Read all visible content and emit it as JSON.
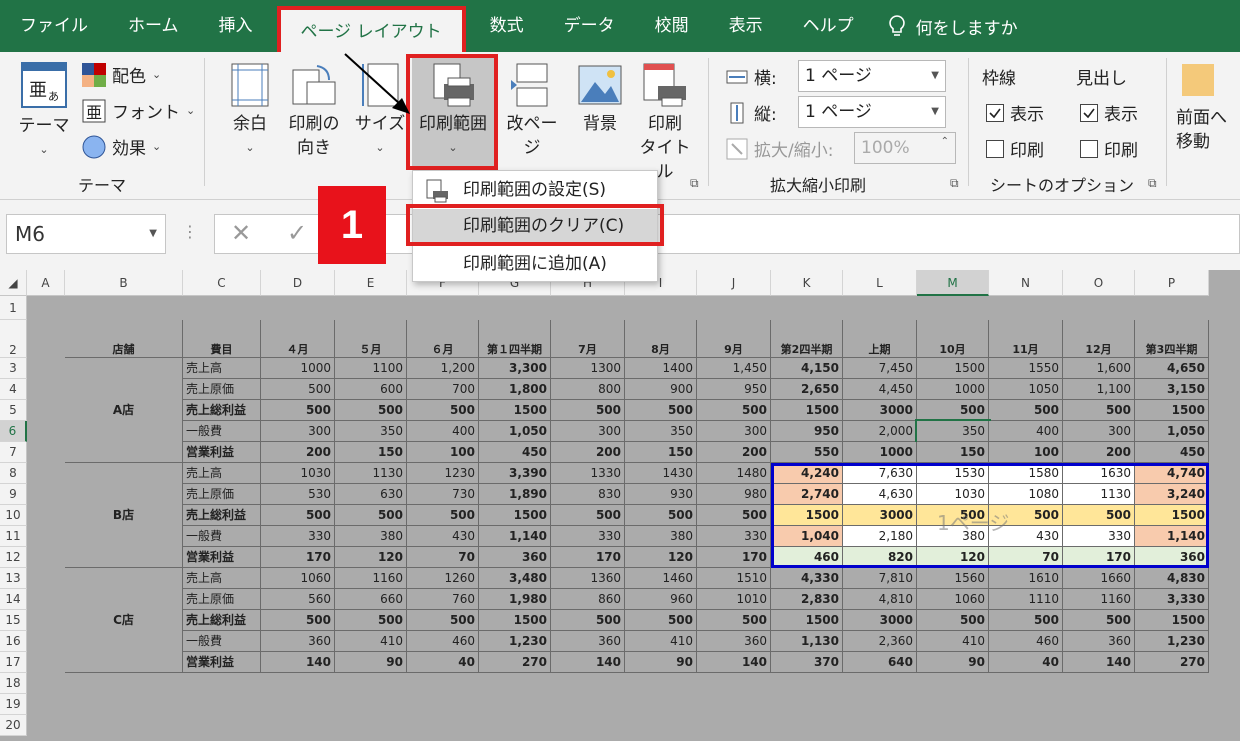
{
  "menu": {
    "tabs": [
      "ファイル",
      "ホーム",
      "挿入",
      "ページ レイアウト",
      "数式",
      "データ",
      "校閲",
      "表示",
      "ヘルプ"
    ],
    "search": "何をしますか"
  },
  "ribbon": {
    "theme": {
      "themes": "テーマ",
      "colors": "配色",
      "fonts": "フォント",
      "effects": "効果",
      "group": "テーマ"
    },
    "margins": "余白",
    "orientation": [
      "印刷の",
      "向き"
    ],
    "size": "サイズ",
    "print_area": "印刷範囲",
    "breaks": "改ページ",
    "background": "背景",
    "print_titles": [
      "印刷",
      "タイトル"
    ],
    "scale": {
      "width_label": "横:",
      "width_value": "1 ページ",
      "height_label": "縦:",
      "height_value": "1 ページ",
      "scale_label": "拡大/縮小:",
      "scale_value": "100%",
      "group": "拡大縮小印刷"
    },
    "sheet_options": {
      "gridlines": "枠線",
      "headings": "見出し",
      "view": "表示",
      "print": "印刷",
      "group": "シートのオプション"
    },
    "arrange": [
      "前面へ",
      "移動"
    ]
  },
  "dropdown": {
    "items": [
      "印刷範囲の設定(S)",
      "印刷範囲のクリア(C)",
      "印刷範囲に追加(A)"
    ]
  },
  "badge": "1",
  "namebox": "M6",
  "columns": [
    "A",
    "B",
    "C",
    "D",
    "E",
    "F",
    "G",
    "H",
    "I",
    "J",
    "K",
    "L",
    "M",
    "N",
    "O",
    "P"
  ],
  "rows": [
    "1",
    "2",
    "3",
    "4",
    "5",
    "6",
    "7",
    "8",
    "9",
    "10",
    "11",
    "12",
    "13",
    "14",
    "15",
    "16",
    "17",
    "18",
    "19",
    "20"
  ],
  "table": {
    "headers": [
      "店舗",
      "費目",
      "４月",
      "５月",
      "６月",
      "第１四半期",
      "7月",
      "8月",
      "9月",
      "第2四半期",
      "上期",
      "10月",
      "11月",
      "12月",
      "第3四半期"
    ],
    "stores": [
      "A店",
      "B店",
      "C店"
    ],
    "items": [
      "売上高",
      "売上原価",
      "売上総利益",
      "一般費",
      "営業利益"
    ],
    "data": [
      [
        "1000",
        "1100",
        "1,200",
        "3,300",
        "1300",
        "1400",
        "1,450",
        "4,150",
        "7,450",
        "1500",
        "1550",
        "1,600",
        "4,650"
      ],
      [
        "500",
        "600",
        "700",
        "1,800",
        "800",
        "900",
        "950",
        "2,650",
        "4,450",
        "1000",
        "1050",
        "1,100",
        "3,150"
      ],
      [
        "500",
        "500",
        "500",
        "1500",
        "500",
        "500",
        "500",
        "1500",
        "3000",
        "500",
        "500",
        "500",
        "1500"
      ],
      [
        "300",
        "350",
        "400",
        "1,050",
        "300",
        "350",
        "300",
        "950",
        "2,000",
        "350",
        "400",
        "300",
        "1,050"
      ],
      [
        "200",
        "150",
        "100",
        "450",
        "200",
        "150",
        "200",
        "550",
        "1000",
        "150",
        "100",
        "200",
        "450"
      ],
      [
        "1030",
        "1130",
        "1230",
        "3,390",
        "1330",
        "1430",
        "1480",
        "4,240",
        "7,630",
        "1530",
        "1580",
        "1630",
        "4,740"
      ],
      [
        "530",
        "630",
        "730",
        "1,890",
        "830",
        "930",
        "980",
        "2,740",
        "4,630",
        "1030",
        "1080",
        "1130",
        "3,240"
      ],
      [
        "500",
        "500",
        "500",
        "1500",
        "500",
        "500",
        "500",
        "1500",
        "3000",
        "500",
        "500",
        "500",
        "1500"
      ],
      [
        "330",
        "380",
        "430",
        "1,140",
        "330",
        "380",
        "330",
        "1,040",
        "2,180",
        "380",
        "430",
        "330",
        "1,140"
      ],
      [
        "170",
        "120",
        "70",
        "360",
        "170",
        "120",
        "170",
        "460",
        "820",
        "120",
        "70",
        "170",
        "360"
      ],
      [
        "1060",
        "1160",
        "1260",
        "3,480",
        "1360",
        "1460",
        "1510",
        "4,330",
        "7,810",
        "1560",
        "1610",
        "1660",
        "4,830"
      ],
      [
        "560",
        "660",
        "760",
        "1,980",
        "860",
        "960",
        "1010",
        "2,830",
        "4,810",
        "1060",
        "1110",
        "1160",
        "3,330"
      ],
      [
        "500",
        "500",
        "500",
        "1500",
        "500",
        "500",
        "500",
        "1500",
        "3000",
        "500",
        "500",
        "500",
        "1500"
      ],
      [
        "360",
        "410",
        "460",
        "1,230",
        "360",
        "410",
        "360",
        "1,130",
        "2,360",
        "410",
        "460",
        "360",
        "1,230"
      ],
      [
        "140",
        "90",
        "40",
        "270",
        "140",
        "90",
        "140",
        "370",
        "640",
        "90",
        "40",
        "140",
        "270"
      ]
    ]
  },
  "page_watermark": "1ページ",
  "colors": {
    "green": "#217346",
    "red": "#e02020",
    "orange": "#f8cbad",
    "yellow": "#ffe699",
    "lightgreen": "#e2efda",
    "blue": "#0000cc"
  }
}
